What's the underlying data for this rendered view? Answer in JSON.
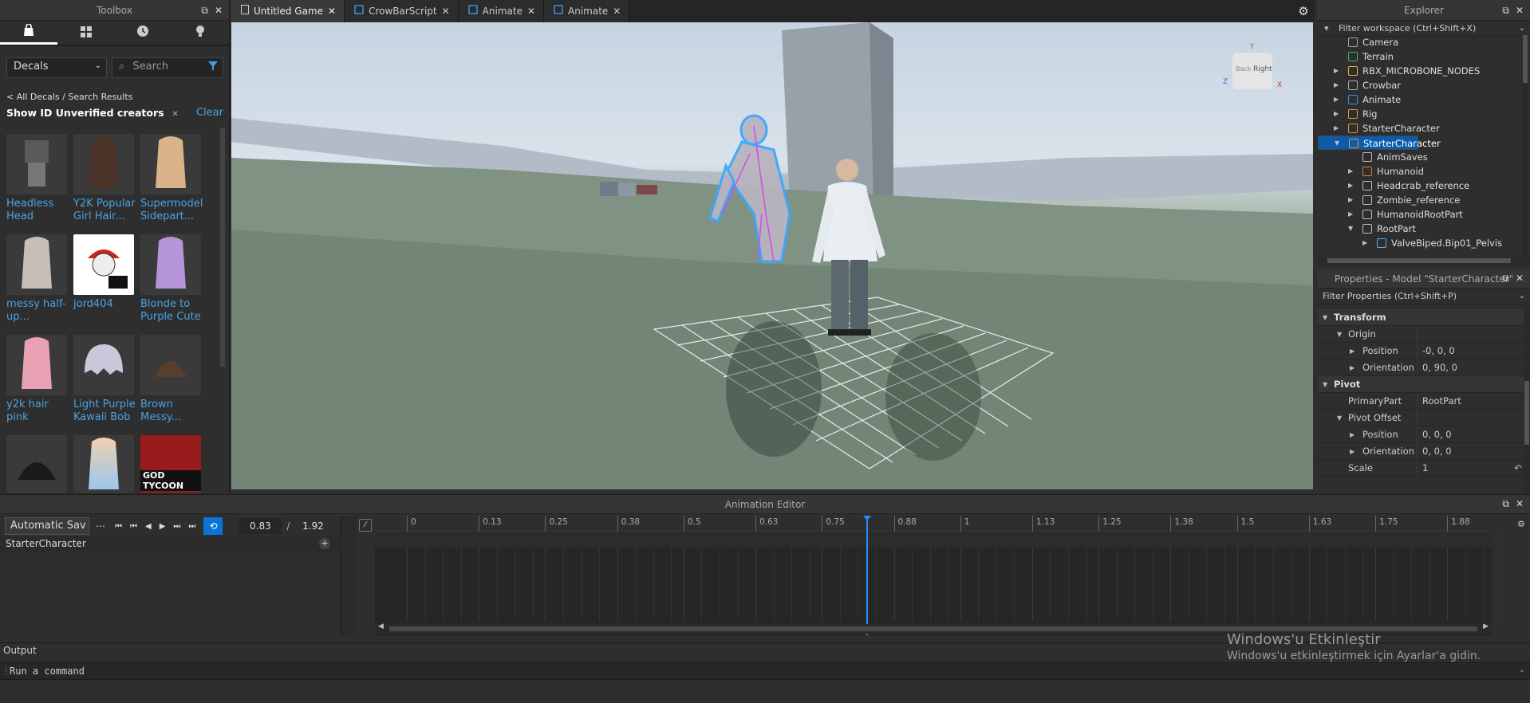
{
  "toolbox": {
    "title": "Toolbox",
    "tabs": [
      {
        "icon": "bag-icon"
      },
      {
        "icon": "grid-icon"
      },
      {
        "icon": "clock-icon"
      },
      {
        "icon": "bulb-icon"
      }
    ],
    "category": "Decals",
    "search_placeholder": "Search",
    "breadcrumb": "< All Decals / Search Results",
    "filter_chip": "Show ID Unverified creators",
    "clear_label": "Clear",
    "items": [
      {
        "name": "Headless Head"
      },
      {
        "name": "Y2K Popular Girl Hair..."
      },
      {
        "name": "Supermodel Sidepart..."
      },
      {
        "name": "messy half-up..."
      },
      {
        "name": "jord404"
      },
      {
        "name": "Blonde to Purple Cute"
      },
      {
        "name": "y2k hair pink"
      },
      {
        "name": "Light Purple Kawaii Bob"
      },
      {
        "name": "Brown Messy..."
      },
      {
        "name": ""
      },
      {
        "name": ""
      },
      {
        "name": "GOD TYCOON"
      }
    ]
  },
  "editor_tabs": [
    {
      "label": "Untitled Game",
      "active": true
    },
    {
      "label": "CrowBarScript",
      "active": false
    },
    {
      "label": "Animate",
      "active": false
    },
    {
      "label": "Animate",
      "active": false
    }
  ],
  "viewport": {
    "gizmo_labels": {
      "right": "Right",
      "back": "Back",
      "x": "X",
      "y": "Y",
      "z": "Z"
    }
  },
  "explorer": {
    "title": "Explorer",
    "filter": "Filter workspace (Ctrl+Shift+X)",
    "items": [
      {
        "label": "Camera",
        "depth": 1,
        "arrow": "",
        "icon": "camera-icon"
      },
      {
        "label": "Terrain",
        "depth": 1,
        "arrow": "",
        "icon": "terrain-icon"
      },
      {
        "label": "RBX_MICROBONE_NODES",
        "depth": 1,
        "arrow": "right",
        "icon": "folder-icon"
      },
      {
        "label": "Crowbar",
        "depth": 1,
        "arrow": "right",
        "icon": "tool-icon"
      },
      {
        "label": "Animate",
        "depth": 1,
        "arrow": "right",
        "icon": "script-icon"
      },
      {
        "label": "Rig",
        "depth": 1,
        "arrow": "right",
        "icon": "model-icon"
      },
      {
        "label": "StarterCharacter",
        "depth": 1,
        "arrow": "right",
        "icon": "model-icon"
      },
      {
        "label": "StarterCharacter",
        "depth": 1,
        "arrow": "down",
        "icon": "model-icon",
        "selected": true
      },
      {
        "label": "AnimSaves",
        "depth": 2,
        "arrow": "",
        "icon": "hash-icon"
      },
      {
        "label": "Humanoid",
        "depth": 2,
        "arrow": "right",
        "icon": "humanoid-icon"
      },
      {
        "label": "Headcrab_reference",
        "depth": 2,
        "arrow": "right",
        "icon": "globe-icon"
      },
      {
        "label": "Zombie_reference",
        "depth": 2,
        "arrow": "right",
        "icon": "globe-icon"
      },
      {
        "label": "HumanoidRootPart",
        "depth": 2,
        "arrow": "right",
        "icon": "part-icon"
      },
      {
        "label": "RootPart",
        "depth": 2,
        "arrow": "down",
        "icon": "part-icon"
      },
      {
        "label": "ValveBiped.Bip01_Pelvis",
        "depth": 3,
        "arrow": "right",
        "icon": "bone-icon"
      }
    ]
  },
  "properties": {
    "title": "Properties - Model \"StarterCharacter\"",
    "filter": "Filter Properties (Ctrl+Shift+P)",
    "rows": [
      {
        "name": "Transform",
        "value": "",
        "type": "cat",
        "indent": 0
      },
      {
        "name": "Origin",
        "value": "",
        "type": "sub",
        "indent": 1
      },
      {
        "name": "Position",
        "value": "-0, 0, 0",
        "type": "prop",
        "indent": 2
      },
      {
        "name": "Orientation",
        "value": "0, 90, 0",
        "type": "prop",
        "indent": 2
      },
      {
        "name": "Pivot",
        "value": "",
        "type": "cat",
        "indent": 0
      },
      {
        "name": "PrimaryPart",
        "value": "RootPart",
        "type": "prop",
        "indent": 1
      },
      {
        "name": "Pivot Offset",
        "value": "",
        "type": "sub",
        "indent": 1
      },
      {
        "name": "Position",
        "value": "0, 0, 0",
        "type": "prop",
        "indent": 2
      },
      {
        "name": "Orientation",
        "value": "0, 0, 0",
        "type": "prop",
        "indent": 2
      },
      {
        "name": "Scale",
        "value": "1",
        "type": "prop",
        "indent": 1
      }
    ]
  },
  "animation_editor": {
    "title": "Animation Editor",
    "save_mode": "Automatic Sav",
    "current_time": "0.83",
    "separator": "/",
    "total_time": "1.92",
    "track_name": "StarterCharacter",
    "ticks": [
      "0",
      "0.13",
      "0.25",
      "0.38",
      "0.5",
      "0.63",
      "0.75",
      "0.88",
      "1",
      "1.13",
      "1.25",
      "1.38",
      "1.5",
      "1.63",
      "1.75",
      "1.88"
    ],
    "playhead": 0.83,
    "duration": 1.92
  },
  "output": {
    "title": "Output",
    "command_placeholder": "Run a command"
  },
  "watermark": {
    "line1": "Windows'u Etkinleştir",
    "line2": "Windows'u etkinleştirmek için Ayarlar'a gidin."
  }
}
